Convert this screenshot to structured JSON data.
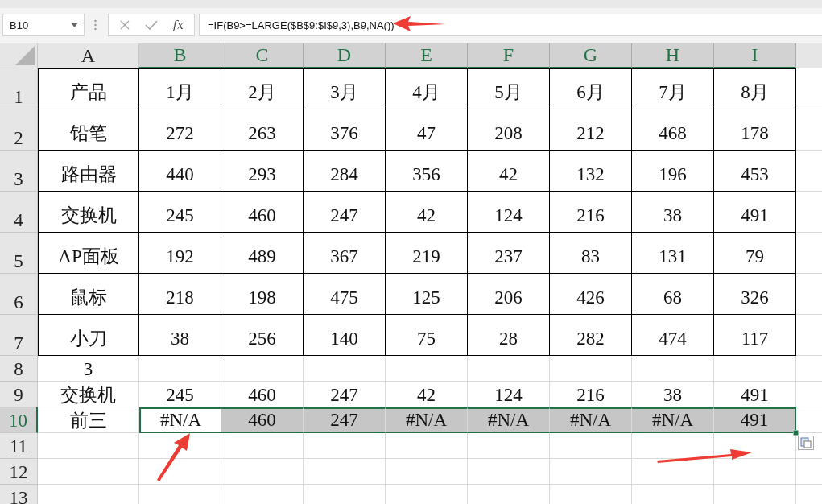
{
  "name_box": "B10",
  "formula_bar": {
    "function_label": "fx",
    "formula": "=IF(B9>=LARGE($B$9:$I$9,3),B9,NA())"
  },
  "columns": [
    {
      "label": "A",
      "selected": false
    },
    {
      "label": "B",
      "selected": true
    },
    {
      "label": "C",
      "selected": true
    },
    {
      "label": "D",
      "selected": true
    },
    {
      "label": "E",
      "selected": true
    },
    {
      "label": "F",
      "selected": true
    },
    {
      "label": "G",
      "selected": true
    },
    {
      "label": "H",
      "selected": true
    },
    {
      "label": "I",
      "selected": true
    }
  ],
  "rows": [
    {
      "label": "1",
      "selected": false,
      "bordered": true,
      "cells": [
        {
          "text": "产品",
          "selected": false,
          "active": false
        },
        {
          "text": "1月",
          "selected": false,
          "active": false
        },
        {
          "text": "2月",
          "selected": false,
          "active": false
        },
        {
          "text": "3月",
          "selected": false,
          "active": false
        },
        {
          "text": "4月",
          "selected": false,
          "active": false
        },
        {
          "text": "5月",
          "selected": false,
          "active": false
        },
        {
          "text": "6月",
          "selected": false,
          "active": false
        },
        {
          "text": "7月",
          "selected": false,
          "active": false
        },
        {
          "text": "8月",
          "selected": false,
          "active": false
        }
      ]
    },
    {
      "label": "2",
      "selected": false,
      "bordered": true,
      "cells": [
        {
          "text": "铅笔",
          "selected": false,
          "active": false
        },
        {
          "text": "272",
          "selected": false,
          "active": false
        },
        {
          "text": "263",
          "selected": false,
          "active": false
        },
        {
          "text": "376",
          "selected": false,
          "active": false
        },
        {
          "text": "47",
          "selected": false,
          "active": false
        },
        {
          "text": "208",
          "selected": false,
          "active": false
        },
        {
          "text": "212",
          "selected": false,
          "active": false
        },
        {
          "text": "468",
          "selected": false,
          "active": false
        },
        {
          "text": "178",
          "selected": false,
          "active": false
        }
      ]
    },
    {
      "label": "3",
      "selected": false,
      "bordered": true,
      "cells": [
        {
          "text": "路由器",
          "selected": false,
          "active": false
        },
        {
          "text": "440",
          "selected": false,
          "active": false
        },
        {
          "text": "293",
          "selected": false,
          "active": false
        },
        {
          "text": "284",
          "selected": false,
          "active": false
        },
        {
          "text": "356",
          "selected": false,
          "active": false
        },
        {
          "text": "42",
          "selected": false,
          "active": false
        },
        {
          "text": "132",
          "selected": false,
          "active": false
        },
        {
          "text": "196",
          "selected": false,
          "active": false
        },
        {
          "text": "453",
          "selected": false,
          "active": false
        }
      ]
    },
    {
      "label": "4",
      "selected": false,
      "bordered": true,
      "cells": [
        {
          "text": "交换机",
          "selected": false,
          "active": false
        },
        {
          "text": "245",
          "selected": false,
          "active": false
        },
        {
          "text": "460",
          "selected": false,
          "active": false
        },
        {
          "text": "247",
          "selected": false,
          "active": false
        },
        {
          "text": "42",
          "selected": false,
          "active": false
        },
        {
          "text": "124",
          "selected": false,
          "active": false
        },
        {
          "text": "216",
          "selected": false,
          "active": false
        },
        {
          "text": "38",
          "selected": false,
          "active": false
        },
        {
          "text": "491",
          "selected": false,
          "active": false
        }
      ]
    },
    {
      "label": "5",
      "selected": false,
      "bordered": true,
      "cells": [
        {
          "text": "AP面板",
          "selected": false,
          "active": false
        },
        {
          "text": "192",
          "selected": false,
          "active": false
        },
        {
          "text": "489",
          "selected": false,
          "active": false
        },
        {
          "text": "367",
          "selected": false,
          "active": false
        },
        {
          "text": "219",
          "selected": false,
          "active": false
        },
        {
          "text": "237",
          "selected": false,
          "active": false
        },
        {
          "text": "83",
          "selected": false,
          "active": false
        },
        {
          "text": "131",
          "selected": false,
          "active": false
        },
        {
          "text": "79",
          "selected": false,
          "active": false
        }
      ]
    },
    {
      "label": "6",
      "selected": false,
      "bordered": true,
      "cells": [
        {
          "text": "鼠标",
          "selected": false,
          "active": false
        },
        {
          "text": "218",
          "selected": false,
          "active": false
        },
        {
          "text": "198",
          "selected": false,
          "active": false
        },
        {
          "text": "475",
          "selected": false,
          "active": false
        },
        {
          "text": "125",
          "selected": false,
          "active": false
        },
        {
          "text": "206",
          "selected": false,
          "active": false
        },
        {
          "text": "426",
          "selected": false,
          "active": false
        },
        {
          "text": "68",
          "selected": false,
          "active": false
        },
        {
          "text": "326",
          "selected": false,
          "active": false
        }
      ]
    },
    {
      "label": "7",
      "selected": false,
      "bordered": true,
      "cells": [
        {
          "text": "小刀",
          "selected": false,
          "active": false
        },
        {
          "text": "38",
          "selected": false,
          "active": false
        },
        {
          "text": "256",
          "selected": false,
          "active": false
        },
        {
          "text": "140",
          "selected": false,
          "active": false
        },
        {
          "text": "75",
          "selected": false,
          "active": false
        },
        {
          "text": "28",
          "selected": false,
          "active": false
        },
        {
          "text": "282",
          "selected": false,
          "active": false
        },
        {
          "text": "474",
          "selected": false,
          "active": false
        },
        {
          "text": "117",
          "selected": false,
          "active": false
        }
      ]
    },
    {
      "label": "8",
      "selected": false,
      "bordered": false,
      "cells": [
        {
          "text": "3",
          "selected": false,
          "active": false
        }
      ]
    },
    {
      "label": "9",
      "selected": false,
      "bordered": false,
      "cells": [
        {
          "text": "交换机",
          "selected": false,
          "active": false
        },
        {
          "text": "245",
          "selected": false,
          "active": false
        },
        {
          "text": "460",
          "selected": false,
          "active": false
        },
        {
          "text": "247",
          "selected": false,
          "active": false
        },
        {
          "text": "42",
          "selected": false,
          "active": false
        },
        {
          "text": "124",
          "selected": false,
          "active": false
        },
        {
          "text": "216",
          "selected": false,
          "active": false
        },
        {
          "text": "38",
          "selected": false,
          "active": false
        },
        {
          "text": "491",
          "selected": false,
          "active": false
        }
      ]
    },
    {
      "label": "10",
      "selected": true,
      "bordered": false,
      "cells": [
        {
          "text": "前三",
          "selected": false,
          "active": false
        },
        {
          "text": "#N/A",
          "selected": true,
          "active": true
        },
        {
          "text": "460",
          "selected": true,
          "active": false
        },
        {
          "text": "247",
          "selected": true,
          "active": false
        },
        {
          "text": "#N/A",
          "selected": true,
          "active": false
        },
        {
          "text": "#N/A",
          "selected": true,
          "active": false
        },
        {
          "text": "#N/A",
          "selected": true,
          "active": false
        },
        {
          "text": "#N/A",
          "selected": true,
          "active": false
        },
        {
          "text": "491",
          "selected": true,
          "active": false
        }
      ]
    },
    {
      "label": "11",
      "selected": false,
      "bordered": false,
      "cells": []
    },
    {
      "label": "12",
      "selected": false,
      "bordered": false,
      "cells": []
    },
    {
      "label": "13",
      "selected": false,
      "bordered": false,
      "cells": []
    }
  ]
}
